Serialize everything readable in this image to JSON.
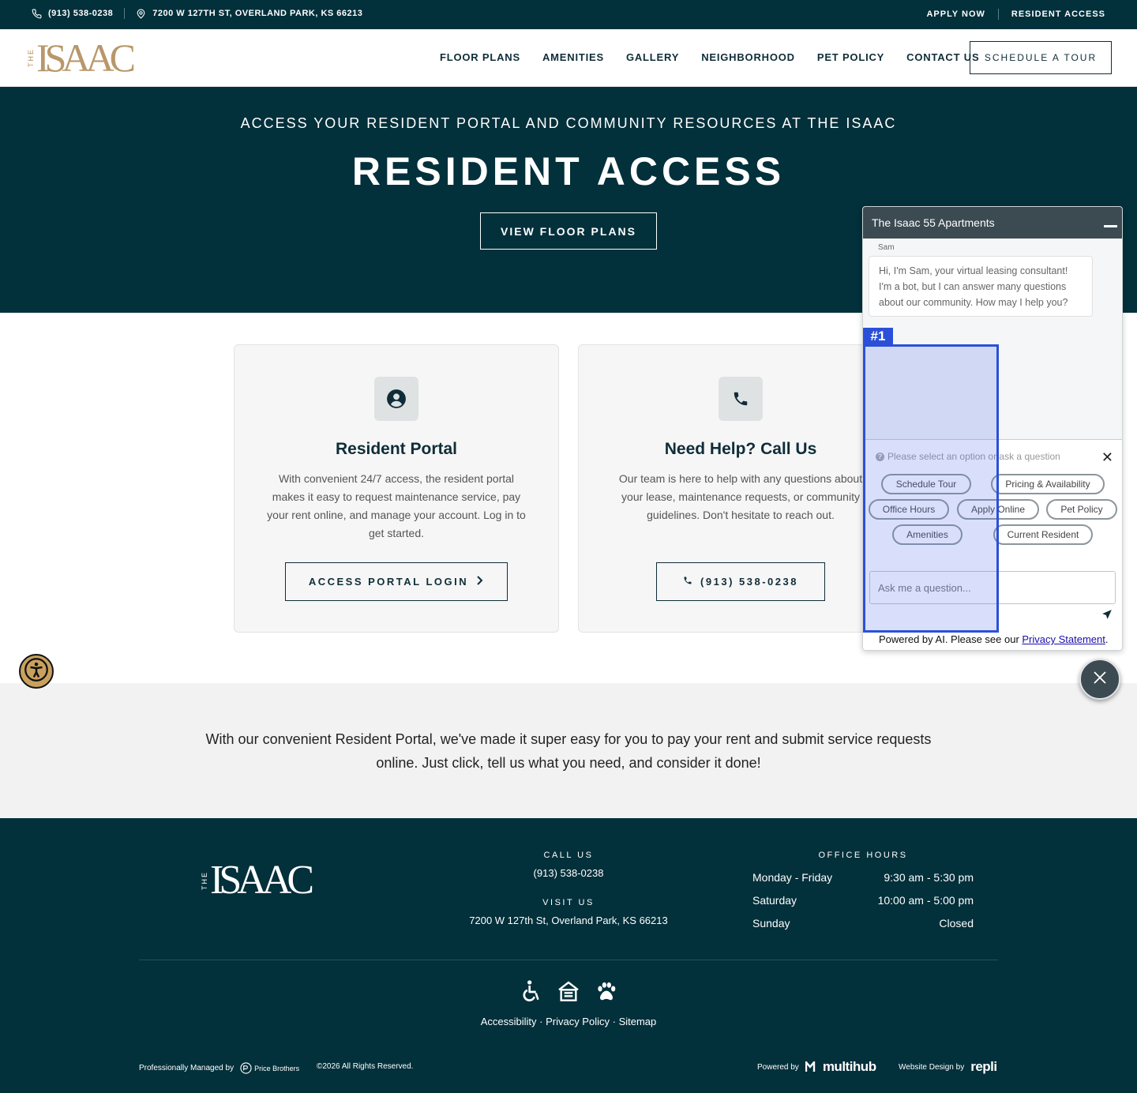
{
  "topbar": {
    "phone": "(913) 538-0238",
    "address": "7200 W 127TH ST, OVERLAND PARK, KS 66213",
    "apply": "APPLY NOW",
    "resident": "RESIDENT ACCESS"
  },
  "header": {
    "logo_the": "THE",
    "logo_word": "ISAAC",
    "nav": [
      "FLOOR PLANS",
      "AMENITIES",
      "GALLERY",
      "NEIGHBORHOOD",
      "PET POLICY",
      "CONTACT US"
    ],
    "schedule": "SCHEDULE A TOUR"
  },
  "hero": {
    "eyebrow": "ACCESS YOUR RESIDENT PORTAL AND COMMUNITY RESOURCES AT THE ISAAC",
    "title": "RESIDENT ACCESS",
    "button": "VIEW FLOOR PLANS"
  },
  "cards": [
    {
      "icon": "user-circle-icon",
      "title": "Resident Portal",
      "text": "With convenient 24/7 access, the resident portal makes it easy to request maintenance service, pay your rent online, and manage your account. Log in to get started.",
      "button": "ACCESS PORTAL LOGIN"
    },
    {
      "icon": "phone-icon",
      "title": "Need Help? Call Us",
      "text": "Our team is here to help with any questions about your lease, maintenance requests, or community guidelines. Don't hesitate to reach out.",
      "button": "(913) 538-0238"
    }
  ],
  "strip": {
    "text": "With our convenient Resident Portal, we've made it super easy for you to pay your rent and submit service requests online. Just click, tell us what you need, and consider it done!"
  },
  "footer": {
    "call_head": "CALL US",
    "call_val": "(913) 538-0238",
    "visit_head": "VISIT US",
    "visit_val": "7200 W 127th St, Overland Park, KS 66213",
    "hours_head": "OFFICE HOURS",
    "hours": [
      {
        "day": "Monday - Friday",
        "time": "9:30 am - 5:30 pm"
      },
      {
        "day": "Saturday",
        "time": "10:00 am - 5:00 pm"
      },
      {
        "day": "Sunday",
        "time": "Closed"
      }
    ],
    "links": {
      "a11y": "Accessibility",
      "privacy": "Privacy Policy",
      "sitemap": "Sitemap",
      "sep": " · "
    },
    "managed": "Professionally Managed by",
    "managed_brand": "Price Brothers",
    "copyright": "©2026 All Rights Reserved.",
    "powered": "Powered by",
    "powered_brand": "multihub",
    "design": "Website Design by",
    "design_brand": "repli"
  },
  "chat": {
    "title": "The Isaac 55 Apartments",
    "sender": "Sam",
    "message": "Hi, I'm Sam, your virtual leasing consultant! I'm a bot, but I can answer many questions about our community. How may I help you?",
    "prompt": "Please select an option or ask a question",
    "options": [
      "Schedule Tour",
      "Pricing & Availability",
      "Office Hours",
      "Apply Online",
      "Pet Policy",
      "Amenities",
      "Current Resident"
    ],
    "placeholder": "Ask me a question...",
    "powered_prefix": "Powered by AI. Please see our ",
    "privacy_link": "Privacy Statement",
    "powered_suffix": "."
  },
  "annotation": {
    "tag": "#1"
  },
  "colors": {
    "navy": "#02303b",
    "gold": "#b8976a",
    "highlight": "#2b50d8"
  }
}
